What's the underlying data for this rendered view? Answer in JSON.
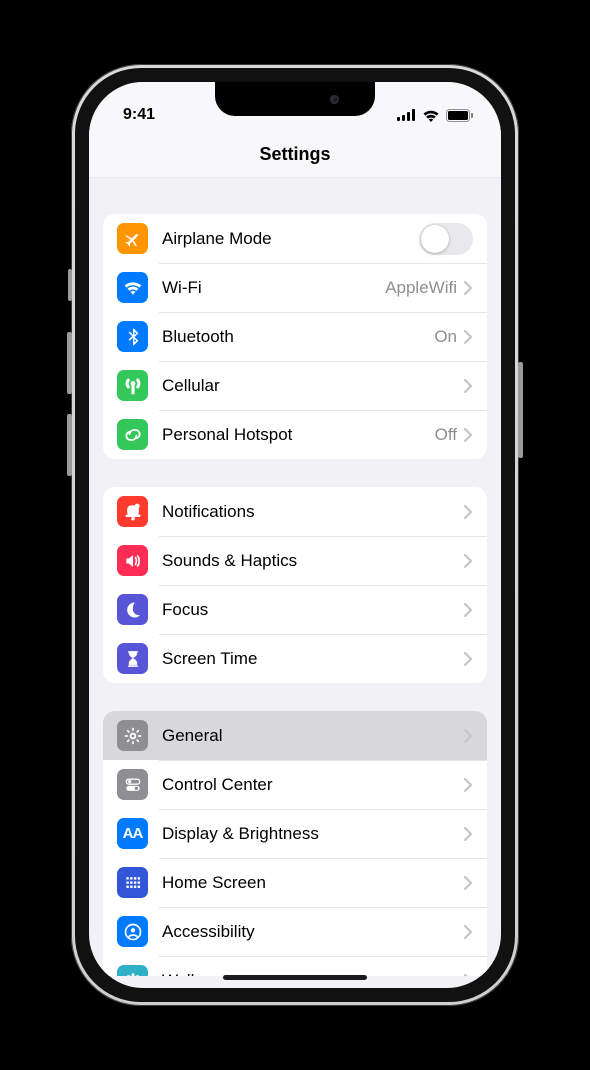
{
  "status": {
    "time": "9:41"
  },
  "header": {
    "title": "Settings"
  },
  "groups": [
    {
      "rows": [
        {
          "id": "airplane-mode",
          "label": "Airplane Mode",
          "icon": "airplane",
          "icon_bg": "bg-orange",
          "control": "toggle",
          "toggle_on": false
        },
        {
          "id": "wifi",
          "label": "Wi-Fi",
          "icon": "wifi",
          "icon_bg": "bg-blue",
          "control": "nav",
          "detail": "AppleWifi"
        },
        {
          "id": "bluetooth",
          "label": "Bluetooth",
          "icon": "bluetooth",
          "icon_bg": "bg-blue",
          "control": "nav",
          "detail": "On"
        },
        {
          "id": "cellular",
          "label": "Cellular",
          "icon": "antenna",
          "icon_bg": "bg-green",
          "control": "nav"
        },
        {
          "id": "personal-hotspot",
          "label": "Personal Hotspot",
          "icon": "link",
          "icon_bg": "bg-green",
          "control": "nav",
          "detail": "Off"
        }
      ]
    },
    {
      "rows": [
        {
          "id": "notifications",
          "label": "Notifications",
          "icon": "bell",
          "icon_bg": "bg-red",
          "control": "nav"
        },
        {
          "id": "sounds-haptics",
          "label": "Sounds & Haptics",
          "icon": "speaker",
          "icon_bg": "bg-pink",
          "control": "nav"
        },
        {
          "id": "focus",
          "label": "Focus",
          "icon": "moon",
          "icon_bg": "bg-indigo",
          "control": "nav"
        },
        {
          "id": "screen-time",
          "label": "Screen Time",
          "icon": "hourglass",
          "icon_bg": "bg-indigo",
          "control": "nav"
        }
      ]
    },
    {
      "rows": [
        {
          "id": "general",
          "label": "General",
          "icon": "gear",
          "icon_bg": "bg-gray",
          "control": "nav",
          "selected": true
        },
        {
          "id": "control-center",
          "label": "Control Center",
          "icon": "switches",
          "icon_bg": "bg-gray",
          "control": "nav"
        },
        {
          "id": "display-brightness",
          "label": "Display & Brightness",
          "icon": "aa",
          "icon_bg": "bg-blue",
          "control": "nav"
        },
        {
          "id": "home-screen",
          "label": "Home Screen",
          "icon": "grid",
          "icon_bg": "bg-darkblue",
          "control": "nav"
        },
        {
          "id": "accessibility",
          "label": "Accessibility",
          "icon": "person-circle",
          "icon_bg": "bg-blue",
          "control": "nav"
        },
        {
          "id": "wallpaper",
          "label": "Wallpaper",
          "icon": "flower",
          "icon_bg": "bg-teal",
          "control": "nav"
        }
      ]
    }
  ]
}
